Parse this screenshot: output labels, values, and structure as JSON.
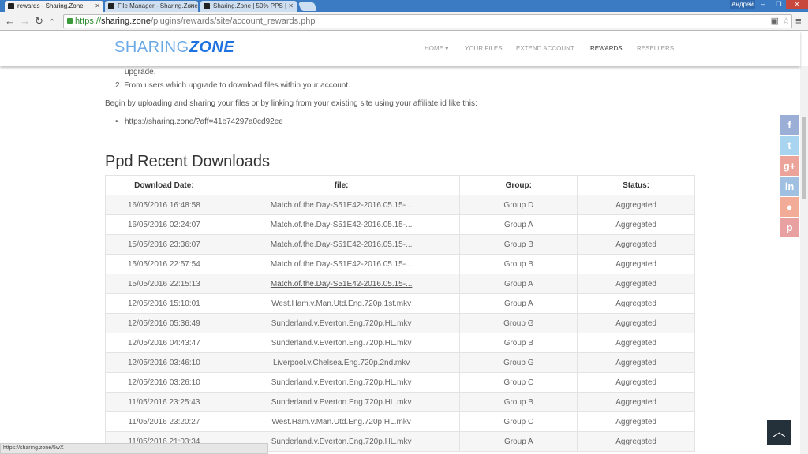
{
  "browser": {
    "tabs": [
      {
        "title": "rewards - Sharing.Zone",
        "active": true
      },
      {
        "title": "File Manager - Sharing.Zone",
        "active": false
      },
      {
        "title": "Sharing.Zone | 50% PPS |",
        "active": false
      }
    ],
    "user": "Андрей",
    "url": {
      "scheme": "https://",
      "domain": "sharing.zone",
      "path": "/plugins/rewards/site/account_rewards.php"
    },
    "status_url": "https://sharing.zone/5wX"
  },
  "site": {
    "logo": {
      "part1": "SHARING",
      "part2": "ZONE"
    },
    "nav": [
      {
        "label": "HOME ▾"
      },
      {
        "label": "YOUR FILES"
      },
      {
        "label": "EXTEND ACCOUNT"
      },
      {
        "label": "REWARDS",
        "active": true
      },
      {
        "label": "RESELLERS"
      }
    ]
  },
  "content": {
    "list_tail": "upgrade.",
    "list_item_2": "2. From users which upgrade to download files within your account.",
    "intro": "Begin by uploading and sharing your files or by linking from your existing site using your affiliate id like this:",
    "affiliate_link": "https://sharing.zone/?aff=41e74297a0cd92ee",
    "heading": "Ppd Recent Downloads",
    "table": {
      "headers": [
        "Download Date:",
        "file:",
        "Group:",
        "Status:"
      ],
      "rows": [
        [
          "16/05/2016 16:48:58",
          "Match.of.the.Day-S51E42-2016.05.15-...",
          "Group D",
          "Aggregated"
        ],
        [
          "16/05/2016 02:24:07",
          "Match.of.the.Day-S51E42-2016.05.15-...",
          "Group A",
          "Aggregated"
        ],
        [
          "15/05/2016 23:36:07",
          "Match.of.the.Day-S51E42-2016.05.15-...",
          "Group B",
          "Aggregated"
        ],
        [
          "15/05/2016 22:57:54",
          "Match.of.the.Day-S51E42-2016.05.15-...",
          "Group B",
          "Aggregated"
        ],
        [
          "15/05/2016 22:15:13",
          "Match.of.the.Day-S51E42-2016.05.15-...",
          "Group A",
          "Aggregated"
        ],
        [
          "12/05/2016 15:10:01",
          "West.Ham.v.Man.Utd.Eng.720p.1st.mkv",
          "Group A",
          "Aggregated"
        ],
        [
          "12/05/2016 05:36:49",
          "Sunderland.v.Everton.Eng.720p.HL.mkv",
          "Group G",
          "Aggregated"
        ],
        [
          "12/05/2016 04:43:47",
          "Sunderland.v.Everton.Eng.720p.HL.mkv",
          "Group B",
          "Aggregated"
        ],
        [
          "12/05/2016 03:46:10",
          "Liverpool.v.Chelsea.Eng.720p.2nd.mkv",
          "Group G",
          "Aggregated"
        ],
        [
          "12/05/2016 03:26:10",
          "Sunderland.v.Everton.Eng.720p.HL.mkv",
          "Group C",
          "Aggregated"
        ],
        [
          "11/05/2016 23:25:43",
          "Sunderland.v.Everton.Eng.720p.HL.mkv",
          "Group B",
          "Aggregated"
        ],
        [
          "11/05/2016 23:20:27",
          "West.Ham.v.Man.Utd.Eng.720p.HL.mkv",
          "Group C",
          "Aggregated"
        ],
        [
          "11/05/2016 21:03:34",
          "Sunderland.v.Everton.Eng.720p.HL.mkv",
          "Group A",
          "Aggregated"
        ]
      ]
    }
  },
  "social": [
    {
      "name": "facebook",
      "glyph": "f",
      "color": "#9aaed6"
    },
    {
      "name": "twitter",
      "glyph": "t",
      "color": "#a8d4ef"
    },
    {
      "name": "google-plus",
      "glyph": "g+",
      "color": "#eba39a"
    },
    {
      "name": "linkedin",
      "glyph": "in",
      "color": "#9fc0e0"
    },
    {
      "name": "reddit",
      "glyph": "●",
      "color": "#f2ab97"
    },
    {
      "name": "pinterest",
      "glyph": "p",
      "color": "#e8a0a0"
    }
  ],
  "back_to_top": "︿"
}
